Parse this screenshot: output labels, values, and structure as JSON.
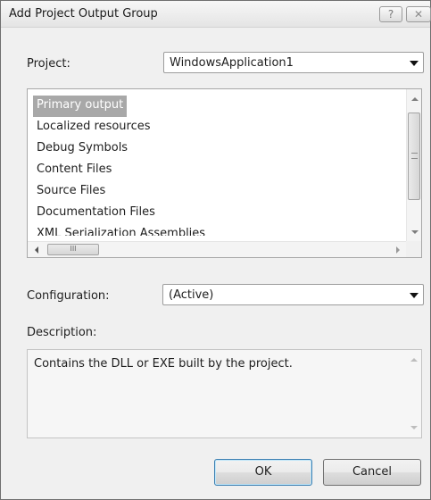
{
  "window": {
    "title": "Add Project Output Group",
    "help_label": "?",
    "close_label": "✕"
  },
  "project": {
    "label": "Project:",
    "value": "WindowsApplication1"
  },
  "outputs": {
    "items": [
      "Primary output",
      "Localized resources",
      "Debug Symbols",
      "Content Files",
      "Source Files",
      "Documentation Files",
      "XML Serialization Assemblies"
    ],
    "selected": "Primary output",
    "hscroll_grip": "III"
  },
  "configuration": {
    "label": "Configuration:",
    "value": "(Active)"
  },
  "description": {
    "label": "Description:",
    "text": "Contains the DLL or EXE built by the project."
  },
  "buttons": {
    "ok": "OK",
    "cancel": "Cancel"
  },
  "colors": {
    "selection": "#a8a8a8",
    "dialog_bg": "#f0f0f0",
    "default_button_border": "#3c7fb1"
  }
}
